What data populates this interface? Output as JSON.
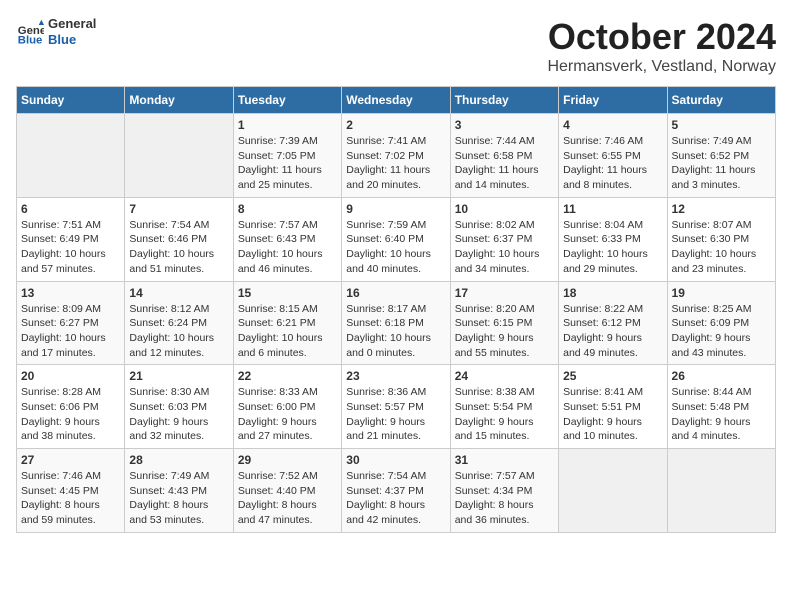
{
  "header": {
    "logo_line1": "General",
    "logo_line2": "Blue",
    "title": "October 2024",
    "subtitle": "Hermansverk, Vestland, Norway"
  },
  "columns": [
    "Sunday",
    "Monday",
    "Tuesday",
    "Wednesday",
    "Thursday",
    "Friday",
    "Saturday"
  ],
  "weeks": [
    [
      {
        "day": "",
        "content": ""
      },
      {
        "day": "",
        "content": ""
      },
      {
        "day": "1",
        "content": "Sunrise: 7:39 AM\nSunset: 7:05 PM\nDaylight: 11 hours\nand 25 minutes."
      },
      {
        "day": "2",
        "content": "Sunrise: 7:41 AM\nSunset: 7:02 PM\nDaylight: 11 hours\nand 20 minutes."
      },
      {
        "day": "3",
        "content": "Sunrise: 7:44 AM\nSunset: 6:58 PM\nDaylight: 11 hours\nand 14 minutes."
      },
      {
        "day": "4",
        "content": "Sunrise: 7:46 AM\nSunset: 6:55 PM\nDaylight: 11 hours\nand 8 minutes."
      },
      {
        "day": "5",
        "content": "Sunrise: 7:49 AM\nSunset: 6:52 PM\nDaylight: 11 hours\nand 3 minutes."
      }
    ],
    [
      {
        "day": "6",
        "content": "Sunrise: 7:51 AM\nSunset: 6:49 PM\nDaylight: 10 hours\nand 57 minutes."
      },
      {
        "day": "7",
        "content": "Sunrise: 7:54 AM\nSunset: 6:46 PM\nDaylight: 10 hours\nand 51 minutes."
      },
      {
        "day": "8",
        "content": "Sunrise: 7:57 AM\nSunset: 6:43 PM\nDaylight: 10 hours\nand 46 minutes."
      },
      {
        "day": "9",
        "content": "Sunrise: 7:59 AM\nSunset: 6:40 PM\nDaylight: 10 hours\nand 40 minutes."
      },
      {
        "day": "10",
        "content": "Sunrise: 8:02 AM\nSunset: 6:37 PM\nDaylight: 10 hours\nand 34 minutes."
      },
      {
        "day": "11",
        "content": "Sunrise: 8:04 AM\nSunset: 6:33 PM\nDaylight: 10 hours\nand 29 minutes."
      },
      {
        "day": "12",
        "content": "Sunrise: 8:07 AM\nSunset: 6:30 PM\nDaylight: 10 hours\nand 23 minutes."
      }
    ],
    [
      {
        "day": "13",
        "content": "Sunrise: 8:09 AM\nSunset: 6:27 PM\nDaylight: 10 hours\nand 17 minutes."
      },
      {
        "day": "14",
        "content": "Sunrise: 8:12 AM\nSunset: 6:24 PM\nDaylight: 10 hours\nand 12 minutes."
      },
      {
        "day": "15",
        "content": "Sunrise: 8:15 AM\nSunset: 6:21 PM\nDaylight: 10 hours\nand 6 minutes."
      },
      {
        "day": "16",
        "content": "Sunrise: 8:17 AM\nSunset: 6:18 PM\nDaylight: 10 hours\nand 0 minutes."
      },
      {
        "day": "17",
        "content": "Sunrise: 8:20 AM\nSunset: 6:15 PM\nDaylight: 9 hours\nand 55 minutes."
      },
      {
        "day": "18",
        "content": "Sunrise: 8:22 AM\nSunset: 6:12 PM\nDaylight: 9 hours\nand 49 minutes."
      },
      {
        "day": "19",
        "content": "Sunrise: 8:25 AM\nSunset: 6:09 PM\nDaylight: 9 hours\nand 43 minutes."
      }
    ],
    [
      {
        "day": "20",
        "content": "Sunrise: 8:28 AM\nSunset: 6:06 PM\nDaylight: 9 hours\nand 38 minutes."
      },
      {
        "day": "21",
        "content": "Sunrise: 8:30 AM\nSunset: 6:03 PM\nDaylight: 9 hours\nand 32 minutes."
      },
      {
        "day": "22",
        "content": "Sunrise: 8:33 AM\nSunset: 6:00 PM\nDaylight: 9 hours\nand 27 minutes."
      },
      {
        "day": "23",
        "content": "Sunrise: 8:36 AM\nSunset: 5:57 PM\nDaylight: 9 hours\nand 21 minutes."
      },
      {
        "day": "24",
        "content": "Sunrise: 8:38 AM\nSunset: 5:54 PM\nDaylight: 9 hours\nand 15 minutes."
      },
      {
        "day": "25",
        "content": "Sunrise: 8:41 AM\nSunset: 5:51 PM\nDaylight: 9 hours\nand 10 minutes."
      },
      {
        "day": "26",
        "content": "Sunrise: 8:44 AM\nSunset: 5:48 PM\nDaylight: 9 hours\nand 4 minutes."
      }
    ],
    [
      {
        "day": "27",
        "content": "Sunrise: 7:46 AM\nSunset: 4:45 PM\nDaylight: 8 hours\nand 59 minutes."
      },
      {
        "day": "28",
        "content": "Sunrise: 7:49 AM\nSunset: 4:43 PM\nDaylight: 8 hours\nand 53 minutes."
      },
      {
        "day": "29",
        "content": "Sunrise: 7:52 AM\nSunset: 4:40 PM\nDaylight: 8 hours\nand 47 minutes."
      },
      {
        "day": "30",
        "content": "Sunrise: 7:54 AM\nSunset: 4:37 PM\nDaylight: 8 hours\nand 42 minutes."
      },
      {
        "day": "31",
        "content": "Sunrise: 7:57 AM\nSunset: 4:34 PM\nDaylight: 8 hours\nand 36 minutes."
      },
      {
        "day": "",
        "content": ""
      },
      {
        "day": "",
        "content": ""
      }
    ]
  ]
}
